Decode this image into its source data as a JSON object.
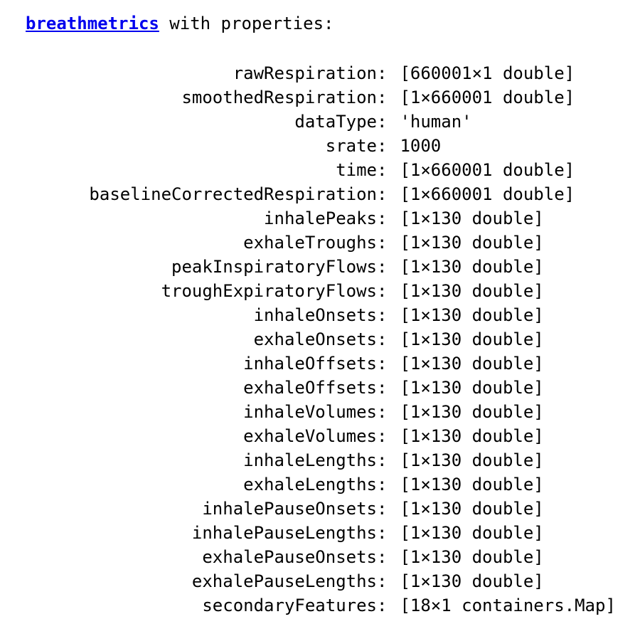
{
  "header": {
    "class_name": "breathmetrics",
    "suffix": " with properties:"
  },
  "properties": [
    {
      "name": "rawRespiration",
      "value": "[660001×1 double]"
    },
    {
      "name": "smoothedRespiration",
      "value": "[1×660001 double]"
    },
    {
      "name": "dataType",
      "value": "'human'"
    },
    {
      "name": "srate",
      "value": "1000"
    },
    {
      "name": "time",
      "value": "[1×660001 double]"
    },
    {
      "name": "baselineCorrectedRespiration",
      "value": "[1×660001 double]"
    },
    {
      "name": "inhalePeaks",
      "value": "[1×130 double]"
    },
    {
      "name": "exhaleTroughs",
      "value": "[1×130 double]"
    },
    {
      "name": "peakInspiratoryFlows",
      "value": "[1×130 double]"
    },
    {
      "name": "troughExpiratoryFlows",
      "value": "[1×130 double]"
    },
    {
      "name": "inhaleOnsets",
      "value": "[1×130 double]"
    },
    {
      "name": "exhaleOnsets",
      "value": "[1×130 double]"
    },
    {
      "name": "inhaleOffsets",
      "value": "[1×130 double]"
    },
    {
      "name": "exhaleOffsets",
      "value": "[1×130 double]"
    },
    {
      "name": "inhaleVolumes",
      "value": "[1×130 double]"
    },
    {
      "name": "exhaleVolumes",
      "value": "[1×130 double]"
    },
    {
      "name": "inhaleLengths",
      "value": "[1×130 double]"
    },
    {
      "name": "exhaleLengths",
      "value": "[1×130 double]"
    },
    {
      "name": "inhalePauseOnsets",
      "value": "[1×130 double]"
    },
    {
      "name": "inhalePauseLengths",
      "value": "[1×130 double]"
    },
    {
      "name": "exhalePauseOnsets",
      "value": "[1×130 double]"
    },
    {
      "name": "exhalePauseLengths",
      "value": "[1×130 double]"
    },
    {
      "name": "secondaryFeatures",
      "value": "[18×1 containers.Map]"
    }
  ],
  "colors": {
    "link": "#0000ee",
    "text": "#000000",
    "background": "#ffffff"
  }
}
